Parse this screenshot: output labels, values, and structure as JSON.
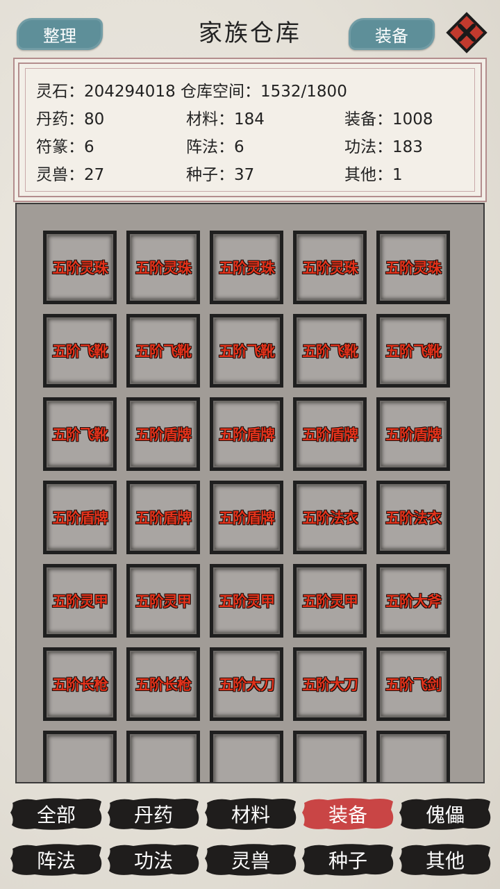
{
  "header": {
    "title": "家族仓库",
    "sort_label": "整理",
    "equip_label": "装备",
    "accent": "#5e8f99",
    "close_color": "#c23a2e"
  },
  "stats": {
    "line1": "灵石：204294018 仓库空间：1532/1800",
    "pills": "丹药：80",
    "materials": "材料：184",
    "equipment": "装备：1008",
    "talismans": "符篆：6",
    "formations": "阵法：6",
    "techniques": "功法：183",
    "beasts": "灵兽：27",
    "seeds": "种子：37",
    "others": "其他：1"
  },
  "items": [
    "五阶灵珠",
    "五阶灵珠",
    "五阶灵珠",
    "五阶灵珠",
    "五阶灵珠",
    "五阶飞靴",
    "五阶飞靴",
    "五阶飞靴",
    "五阶飞靴",
    "五阶飞靴",
    "五阶飞靴",
    "五阶盾牌",
    "五阶盾牌",
    "五阶盾牌",
    "五阶盾牌",
    "五阶盾牌",
    "五阶盾牌",
    "五阶盾牌",
    "五阶法衣",
    "五阶法衣",
    "五阶灵甲",
    "五阶灵甲",
    "五阶灵甲",
    "五阶灵甲",
    "五阶大斧",
    "五阶长枪",
    "五阶长枪",
    "五阶大刀",
    "五阶大刀",
    "五阶飞剑",
    "",
    "",
    "",
    "",
    ""
  ],
  "tabs": [
    {
      "label": "全部",
      "active": false
    },
    {
      "label": "丹药",
      "active": false
    },
    {
      "label": "材料",
      "active": false
    },
    {
      "label": "装备",
      "active": true
    },
    {
      "label": "傀儡",
      "active": false
    },
    {
      "label": "阵法",
      "active": false
    },
    {
      "label": "功法",
      "active": false
    },
    {
      "label": "灵兽",
      "active": false
    },
    {
      "label": "种子",
      "active": false
    },
    {
      "label": "其他",
      "active": false
    }
  ],
  "colors": {
    "tab_active": "#c94545",
    "tab_inactive": "#1f1d1c",
    "item_text": "#e3321b"
  }
}
